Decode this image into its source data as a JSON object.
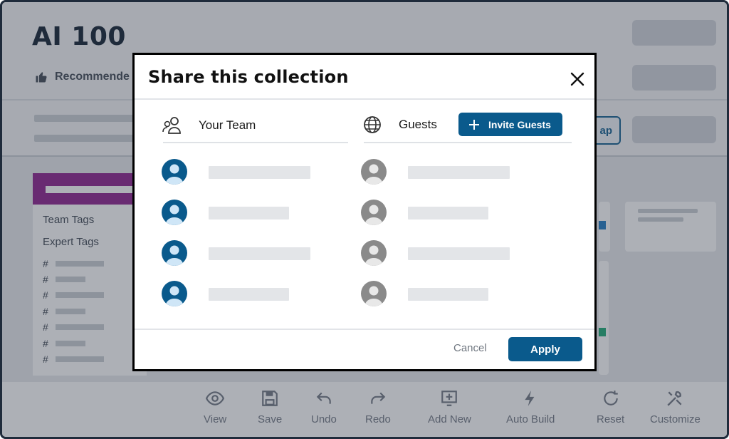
{
  "app": {
    "title": "AI 100",
    "recommended_label": "Recommende",
    "map_button_label": "ap",
    "left_panel": {
      "team_tags_label": "Team Tags",
      "expert_tags_label": "Expert Tags",
      "hash_symbol": "#"
    },
    "bottom_toolbar": [
      {
        "label": "View",
        "icon": "eye-icon"
      },
      {
        "label": "Save",
        "icon": "save-icon"
      },
      {
        "label": "Undo",
        "icon": "undo-icon"
      },
      {
        "label": "Redo",
        "icon": "redo-icon"
      },
      {
        "label": "Add New",
        "icon": "add-new-icon"
      },
      {
        "label": "Auto Build",
        "icon": "lightning-icon"
      },
      {
        "label": "Reset",
        "icon": "reset-icon"
      },
      {
        "label": "Customize",
        "icon": "tools-icon"
      }
    ]
  },
  "modal": {
    "title": "Share this collection",
    "close_icon": "close-icon",
    "your_team": {
      "label": "Your Team",
      "icon": "team-icon",
      "avatar_color": "#0a5a8c"
    },
    "guests": {
      "label": "Guests",
      "icon": "globe-icon",
      "avatar_color": "#8a8a8a",
      "invite_label": "Invite Guests"
    },
    "cancel_label": "Cancel",
    "apply_label": "Apply"
  },
  "colors": {
    "primary": "#0a5a8c",
    "panel_accent": "#8a1a8a",
    "title_text": "#0b1a2b"
  }
}
